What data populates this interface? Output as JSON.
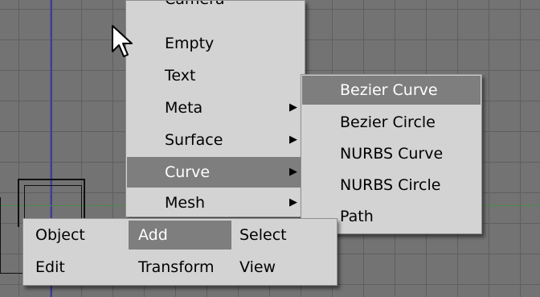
{
  "add_menu": {
    "partial_top_label": "Camera",
    "items": [
      {
        "label": "Empty",
        "has_submenu": false,
        "highlighted": false
      },
      {
        "label": "Text",
        "has_submenu": false,
        "highlighted": false
      },
      {
        "label": "Meta",
        "has_submenu": true,
        "highlighted": false
      },
      {
        "label": "Surface",
        "has_submenu": true,
        "highlighted": false
      },
      {
        "label": "Curve",
        "has_submenu": true,
        "highlighted": true
      },
      {
        "label": "Mesh",
        "has_submenu": true,
        "highlighted": false
      }
    ]
  },
  "curve_submenu": {
    "items": [
      {
        "label": "Bezier Curve",
        "highlighted": true
      },
      {
        "label": "Bezier Circle",
        "highlighted": false
      },
      {
        "label": "NURBS Curve",
        "highlighted": false
      },
      {
        "label": "NURBS Circle",
        "highlighted": false
      },
      {
        "label": "Path",
        "highlighted": false
      }
    ]
  },
  "toolbox": {
    "row1": [
      {
        "label": "Object",
        "highlighted": false
      },
      {
        "label": "Add",
        "highlighted": true
      },
      {
        "label": "Select",
        "highlighted": false
      }
    ],
    "row2": [
      {
        "label": "Edit",
        "highlighted": false
      },
      {
        "label": "Transform",
        "highlighted": false
      },
      {
        "label": "View",
        "highlighted": false
      }
    ]
  },
  "icons": {
    "submenu_arrow": "triangle-right-icon",
    "cursor": "mouse-pointer-icon"
  },
  "colors": {
    "viewport_bg": "#737373",
    "grid_line": "#5f5f5f",
    "menu_bg": "#d3d3d3",
    "highlight_bg": "#7e7e7e",
    "highlight_text": "#ffffff",
    "axis_blue": "#3c3caa",
    "axis_green": "#4a8a4a"
  }
}
